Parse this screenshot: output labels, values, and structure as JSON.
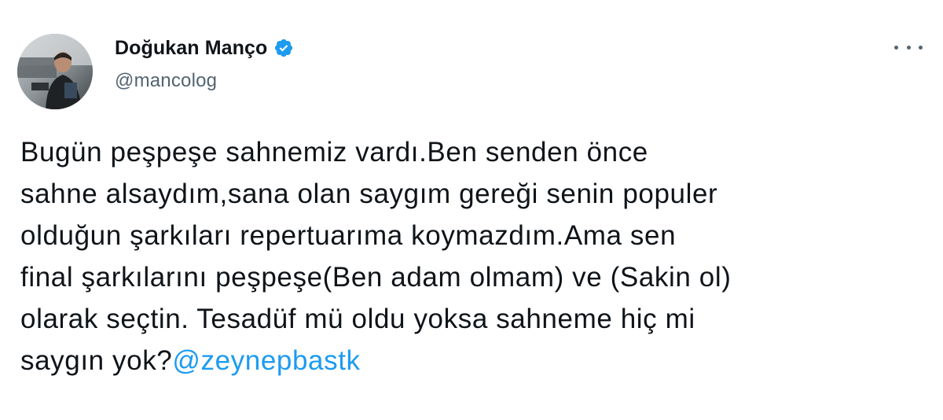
{
  "author": {
    "display_name": "Doğukan Manço",
    "handle": "@mancolog",
    "verified": true,
    "avatar_icon": "profile-photo-avatar"
  },
  "menu": {
    "icon": "more-options-icon"
  },
  "tweet": {
    "lines": [
      "Bugün peşpeşe sahnemiz vardı.Ben senden önce",
      "sahne alsaydım,sana olan saygım gereği senin populer",
      "olduğun şarkıları repertuarıma koymazdım.Ama sen",
      "final şarkılarını peşpeşe(Ben adam olmam) ve (Sakin ol)",
      "olarak seçtin. Tesadüf mü oldu yoksa sahneme hiç mi"
    ],
    "last_line_text": "saygın yok?",
    "mention": "@zeynepbastk"
  },
  "colors": {
    "text": "#0f1419",
    "secondary": "#536471",
    "link": "#1d9bf0",
    "verified_badge": "#1d9bf0"
  }
}
